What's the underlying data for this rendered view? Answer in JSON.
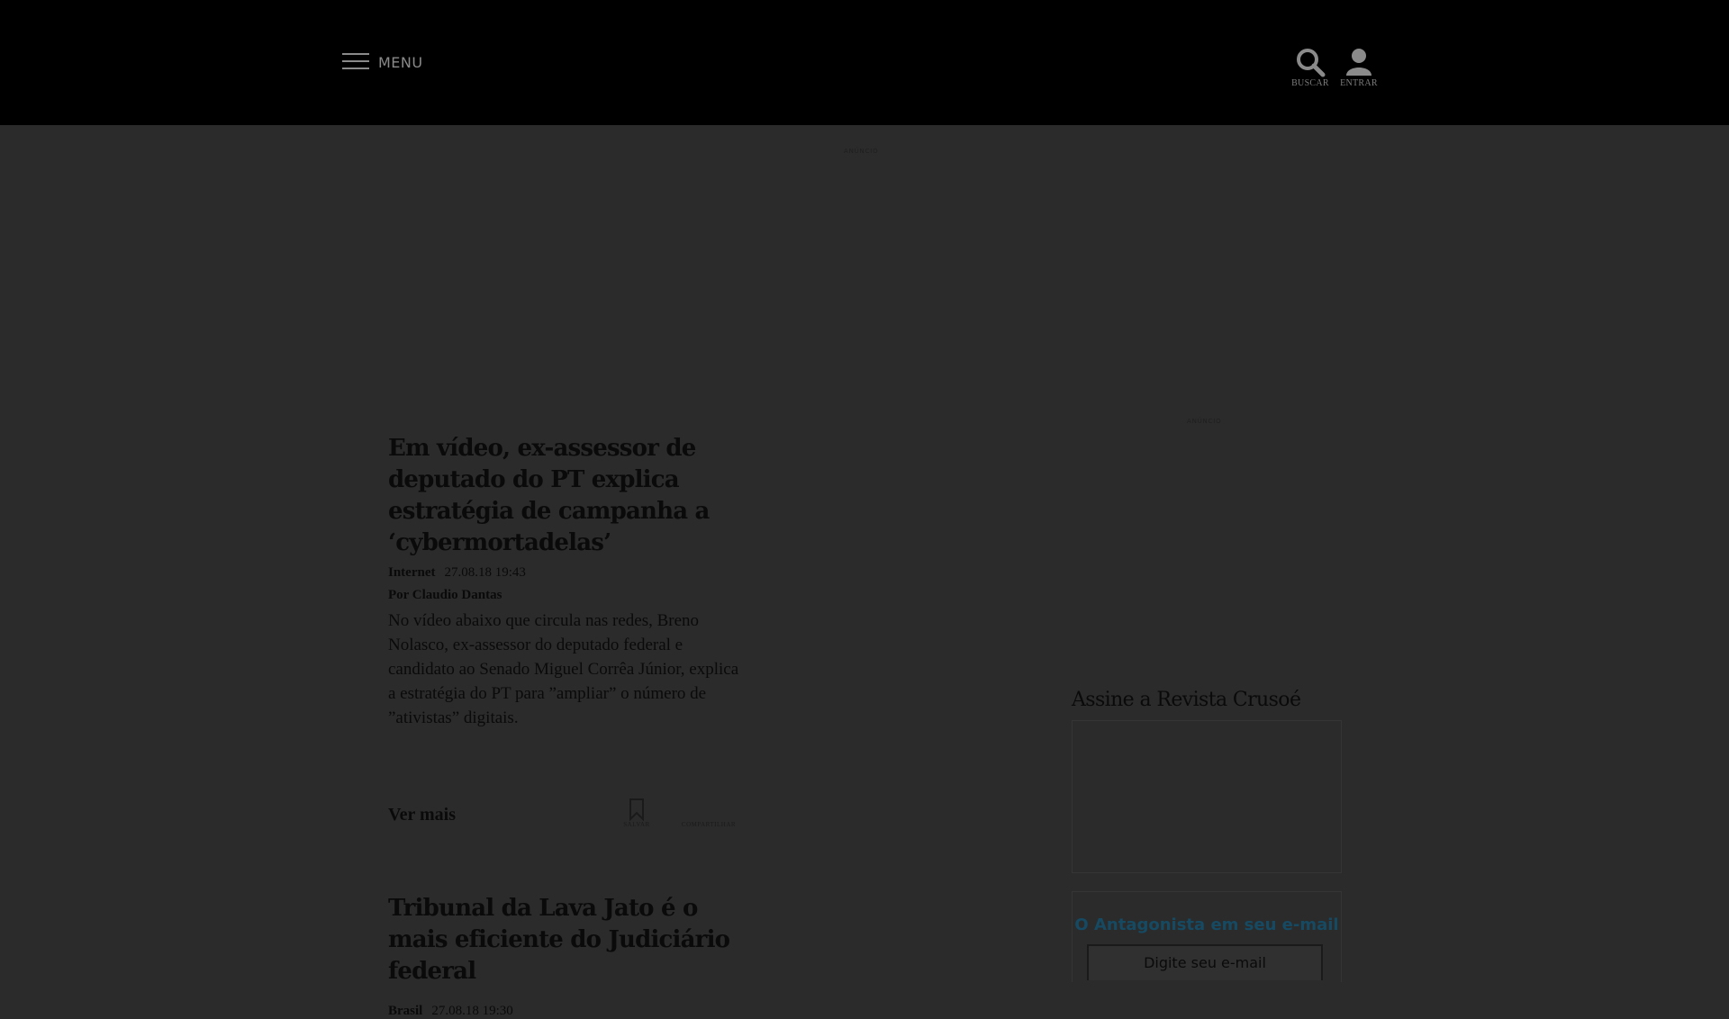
{
  "header": {
    "menu_label": "MENU",
    "search_label": "BUSCAR",
    "login_label": "ENTRAR"
  },
  "ads": {
    "top_label": "ANÚNCIO",
    "side_label": "ANÚNCIO"
  },
  "articles": [
    {
      "title": "Em vídeo, ex-assessor de deputado do PT explica estratégia de campanha a ‘cybermortadelas’",
      "category": "Internet",
      "date": "27.08.18 19:43",
      "author": "Por Claudio Dantas",
      "summary": "No vídeo abaixo que circula nas redes, Breno Nolasco, ex-assessor do deputado federal e candidato ao Senado Miguel Corrêa Júnior, explica a estratégia do PT para ”ampliar” o número de ”ativistas” digitais."
    },
    {
      "title": "Tribunal da Lava Jato é o mais eficiente do Judiciário federal",
      "category": "Brasil",
      "date": "27.08.18 19:30"
    }
  ],
  "article_actions": {
    "ver_mais": "Ver mais",
    "save_label": "SALVAR",
    "share_label": "COMPARTILHAR"
  },
  "sidebar": {
    "subscribe_title": "Assine a Revista Crusoé",
    "newsletter_title": "O Antagonista em seu e-mail",
    "email_placeholder": "Digite seu e-mail"
  },
  "colors": {
    "overlay": "#2b2b2b",
    "header": "#000000",
    "newsletter_title": "#164a63"
  }
}
